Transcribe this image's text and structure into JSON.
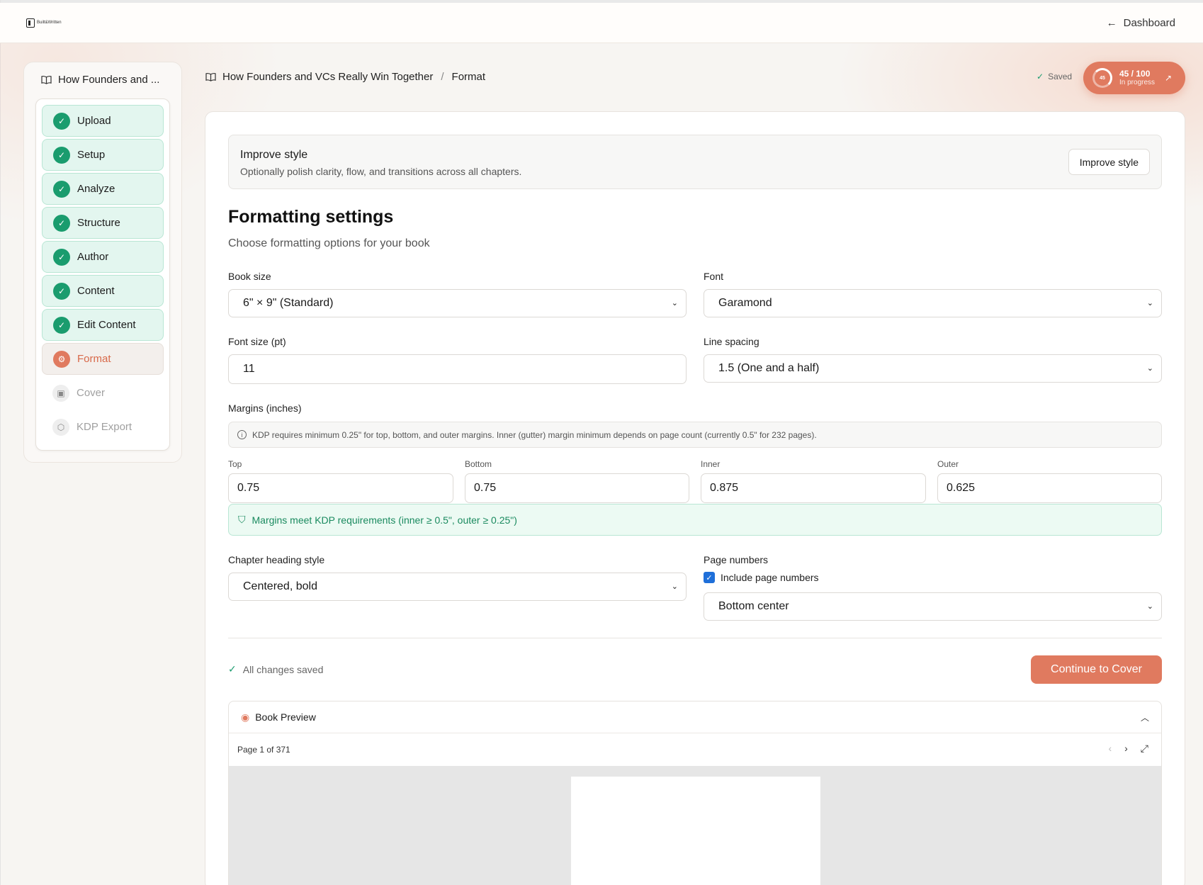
{
  "topbar": {
    "logo_text": "Built&Written",
    "dashboard_label": "Dashboard"
  },
  "sidebar": {
    "book_title": "How Founders and ...",
    "steps": [
      {
        "label": "Upload",
        "status": "done"
      },
      {
        "label": "Setup",
        "status": "done"
      },
      {
        "label": "Analyze",
        "status": "done"
      },
      {
        "label": "Structure",
        "status": "done"
      },
      {
        "label": "Author",
        "status": "done"
      },
      {
        "label": "Content",
        "status": "done"
      },
      {
        "label": "Edit Content",
        "status": "done"
      },
      {
        "label": "Format",
        "status": "active"
      },
      {
        "label": "Cover",
        "status": "todo"
      },
      {
        "label": "KDP Export",
        "status": "todo"
      }
    ]
  },
  "header": {
    "breadcrumb_book": "How Founders and VCs Really Win Together",
    "breadcrumb_sep": "/",
    "breadcrumb_page": "Format",
    "saved_label": "Saved",
    "progress": {
      "ring_value": "45",
      "score": "45 / 100",
      "status": "In progress",
      "fraction": 0.45
    }
  },
  "improve": {
    "title": "Improve style",
    "subtitle": "Optionally polish clarity, flow, and transitions across all chapters.",
    "button": "Improve style"
  },
  "formatting": {
    "title": "Formatting settings",
    "subtitle": "Choose formatting options for your book",
    "book_size_label": "Book size",
    "book_size_value": "6\" × 9\" (Standard)",
    "font_label": "Font",
    "font_value": "Garamond",
    "font_size_label": "Font size (pt)",
    "font_size_value": "11",
    "line_spacing_label": "Line spacing",
    "line_spacing_value": "1.5 (One and a half)",
    "margins_label": "Margins (inches)",
    "margins_info": "KDP requires minimum 0.25\" for top, bottom, and outer margins. Inner (gutter) margin minimum depends on page count (currently 0.5\" for 232 pages).",
    "margins": {
      "top_label": "Top",
      "top_value": "0.75",
      "bottom_label": "Bottom",
      "bottom_value": "0.75",
      "inner_label": "Inner",
      "inner_value": "0.875",
      "outer_label": "Outer",
      "outer_value": "0.625"
    },
    "margins_ok": "Margins meet KDP requirements (inner ≥ 0.5\", outer ≥ 0.25\")",
    "chapter_heading_label": "Chapter heading style",
    "chapter_heading_value": "Centered, bold",
    "page_numbers_label": "Page numbers",
    "include_page_numbers_label": "Include page numbers",
    "include_page_numbers_checked": true,
    "page_number_position": "Bottom center"
  },
  "footer": {
    "all_saved": "All changes saved",
    "continue_button": "Continue to Cover"
  },
  "preview": {
    "title": "Book Preview",
    "page_indicator": "Page 1 of 371"
  },
  "colors": {
    "accent": "#e07a5f",
    "success": "#1a9c6e",
    "success_bg": "#ecfaf3",
    "checkbox": "#1f6fd9"
  }
}
